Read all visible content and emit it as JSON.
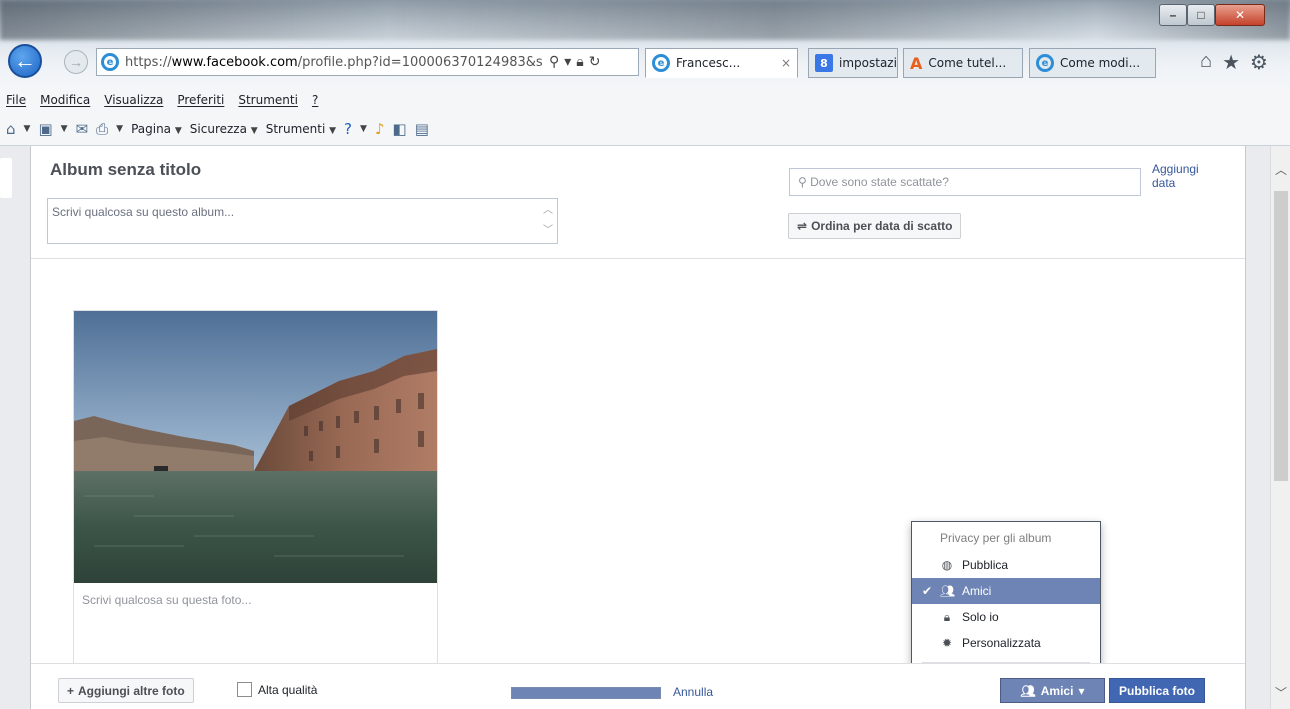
{
  "browser": {
    "address": {
      "url_scheme": "https://",
      "url_domain": "www.facebook.com",
      "url_path": "/profile.php?id=100006370124983&s"
    },
    "tabs": [
      {
        "label": "Francesc...",
        "active": true,
        "icon": "ie-icon"
      },
      {
        "label": "impostazio...",
        "active": false,
        "icon": "google-icon"
      },
      {
        "label": "Come tutel...",
        "active": false,
        "icon": "aranzulla-icon"
      },
      {
        "label": "Come modi...",
        "active": false,
        "icon": "ie-icon"
      }
    ],
    "tab_close_glyph": "×",
    "menu": [
      "File",
      "Modifica",
      "Visualizza",
      "Preferiti",
      "Strumenti",
      "?"
    ],
    "commands": {
      "page": "Pagina",
      "security": "Sicurezza",
      "tools": "Strumenti"
    }
  },
  "album": {
    "title": "Album senza titolo",
    "description_placeholder": "Scrivi qualcosa su questo album...",
    "location_placeholder": "Dove sono state scattate?",
    "add_date_label": "Aggiungi\ndata",
    "sort_label": "Ordina per data di scatto",
    "photo_caption_placeholder": "Scrivi qualcosa su questa foto..."
  },
  "privacy_menu": {
    "header": "Privacy per gli album",
    "items": [
      {
        "label": "Pubblica",
        "icon": "globe-icon",
        "selected": false
      },
      {
        "label": "Amici",
        "icon": "friends-icon",
        "selected": true
      },
      {
        "label": "Solo io",
        "icon": "lock-icon",
        "selected": false
      },
      {
        "label": "Personalizzata",
        "icon": "gear-icon",
        "selected": false
      }
    ]
  },
  "footer": {
    "add_more_label": "Aggiungi altre foto",
    "high_quality_label": "Alta qualità",
    "upload_progress": 1.0,
    "cancel_label": "Annulla",
    "audience_label": "Amici",
    "publish_label": "Pubblica foto"
  },
  "colors": {
    "facebook_blue": "#4267b2",
    "menu_highlight": "#6d84b4",
    "link": "#365899"
  }
}
